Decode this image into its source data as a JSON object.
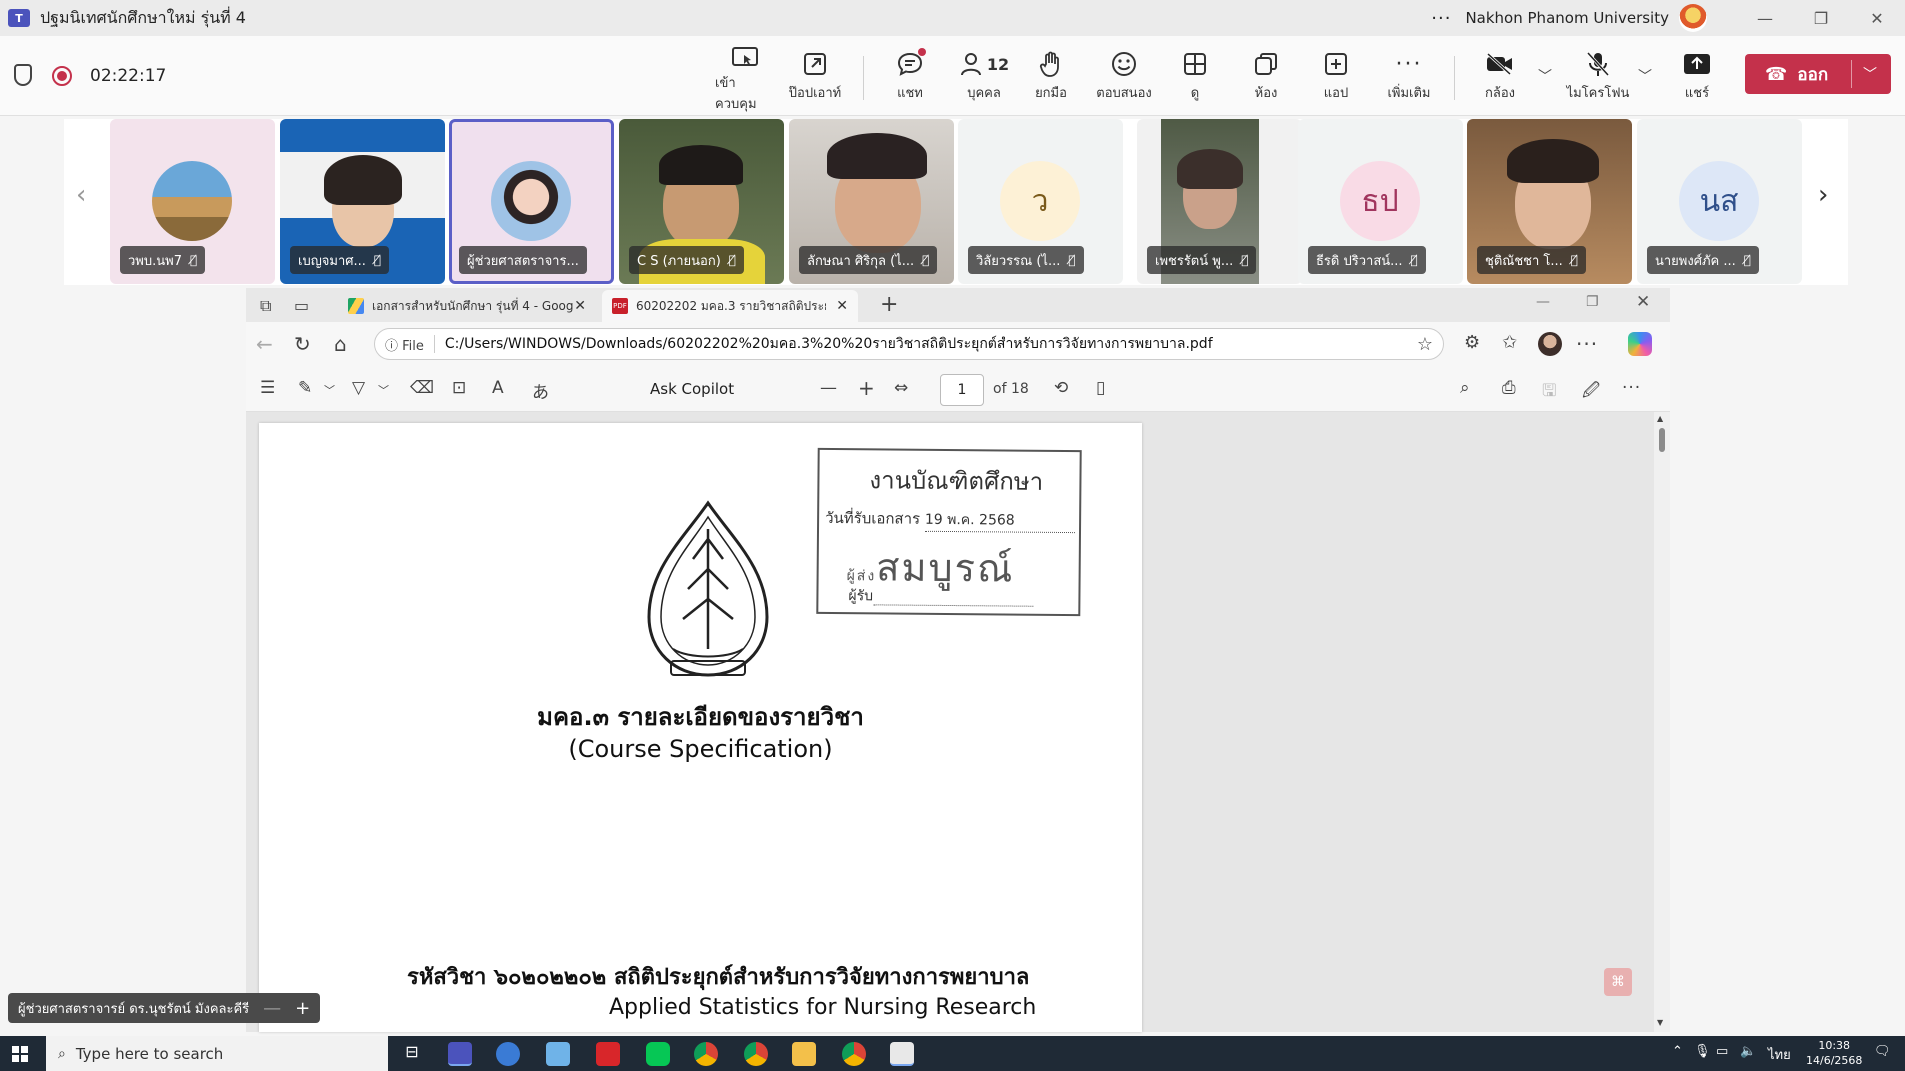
{
  "window": {
    "app_logo": "T",
    "title": "ปฐมนิเทศนักศึกษาใหม่ รุ่นที่ 4",
    "org": "Nakhon Phanom University",
    "more": "···",
    "minimize": "—",
    "maximize": "❐",
    "close": "✕"
  },
  "meeting": {
    "timer": "02:22:17",
    "controls": [
      {
        "label": "เข้าควบคุม",
        "icon": "take-control-icon"
      },
      {
        "label": "ป๊อปเอาท์",
        "icon": "pop-out-icon"
      },
      {
        "label": "แชท",
        "icon": "chat-icon"
      },
      {
        "label": "บุคคล",
        "icon": "people-icon",
        "count": "12"
      },
      {
        "label": "ยกมือ",
        "icon": "raise-hand-icon"
      },
      {
        "label": "ตอบสนอง",
        "icon": "react-icon"
      },
      {
        "label": "ดู",
        "icon": "view-icon"
      },
      {
        "label": "ห้อง",
        "icon": "rooms-icon"
      },
      {
        "label": "แอป",
        "icon": "apps-icon"
      },
      {
        "label": "เพิ่มเติม",
        "icon": "more-icon"
      },
      {
        "label": "กล้อง",
        "icon": "camera-off-icon"
      },
      {
        "label": "ไมโครโฟน",
        "icon": "mic-off-icon"
      },
      {
        "label": "แชร์",
        "icon": "share-icon"
      }
    ],
    "leave_label": "ออก"
  },
  "participants": [
    {
      "name": "วพบ.นพ7",
      "type": "photo"
    },
    {
      "name": "เบญจมาศ...",
      "type": "video"
    },
    {
      "name": "ผู้ช่วยศาสตราจาร...",
      "type": "photo"
    },
    {
      "name": "C S (ภายนอก)",
      "type": "video"
    },
    {
      "name": "ลักษณา ศิริกุล (ไ...",
      "type": "video"
    },
    {
      "name": "วิลัยวรรณ (ไ...",
      "type": "initials",
      "initials": "ว",
      "bg": "#fdf1d6",
      "fg": "#7a5a1a"
    },
    {
      "name": "เพชรรัตน์ พู...",
      "type": "video"
    },
    {
      "name": "ธีรดิ ปริวาสน์...",
      "type": "initials",
      "initials": "ธป",
      "bg": "#f9dbe6",
      "fg": "#a1355e"
    },
    {
      "name": "ชุติณัชชา โ...",
      "type": "video"
    },
    {
      "name": "นายพงศ์ภัค ...",
      "type": "initials",
      "initials": "นส",
      "bg": "#dde7f7",
      "fg": "#2f4f8a"
    }
  ],
  "browser": {
    "tabs": [
      {
        "title": "เอกสารสำหรับนักศึกษา รุ่นที่ 4 - Goog"
      },
      {
        "title": "60202202 มคอ.3 รายวิชาสถิติประยุกต์ส"
      }
    ],
    "new_tab": "+",
    "file_label": "ⓘ File",
    "url": "C:/Users/WINDOWS/Downloads/60202202%20มคอ.3%20%20รายวิชาสถิติประยุกต์สำหรับการวิจัยทางการพยาบาล.pdf"
  },
  "pdf_toolbar": {
    "ask_copilot": "Ask Copilot",
    "page_value": "1",
    "page_of": "of 18"
  },
  "document": {
    "stamp_title": "งานบัณฑิตศึกษา",
    "stamp_date_label": "วันที่รับเอกสาร",
    "stamp_date": "19 พ.ค. 2568",
    "stamp_sender_label": "ผู้ส่ง",
    "stamp_sender": "สมบูรณ์",
    "stamp_receiver_label": "ผู้รับ",
    "title_th": "มคอ.๓ รายละเอียดของรายวิชา",
    "title_en": "(Course Specification)",
    "course_line": "รหัสวิชา ๖๐๒๐๒๒๐๒  สถิติประยุกต์สำหรับการวิจัยทางการพยาบาล",
    "course_en": "Applied Statistics for Nursing Research"
  },
  "presenter": {
    "name": "ผู้ช่วยศาสตราจารย์ ดร.นุชรัตน์ มังคละคีรี"
  },
  "taskbar": {
    "search_placeholder": "Type here to search",
    "lang": "ไทย",
    "time": "10:38",
    "date": "14/6/2568"
  }
}
